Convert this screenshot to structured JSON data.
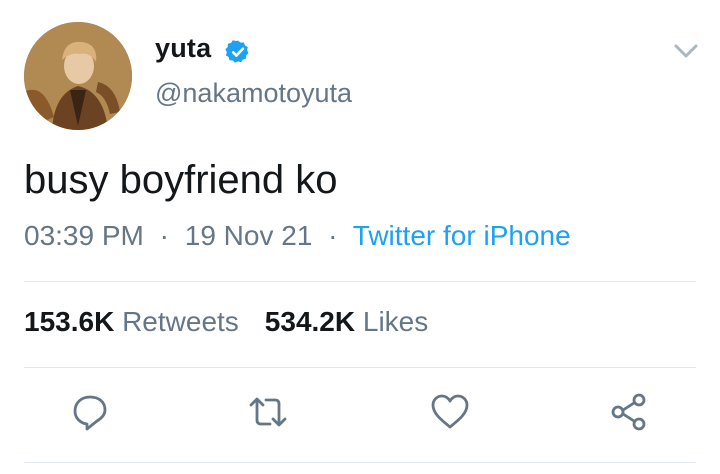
{
  "user": {
    "display_name": "yuta",
    "handle": "@nakamotoyuta",
    "verified": true
  },
  "tweet": {
    "text": "busy boyfriend ko",
    "time": "03:39 PM",
    "date": "19 Nov 21",
    "source": "Twitter for iPhone",
    "separator": "·"
  },
  "stats": {
    "retweets_count": "153.6K",
    "retweets_label": "Retweets",
    "likes_count": "534.2K",
    "likes_label": "Likes"
  },
  "icons": {
    "verified": "verified-badge-icon",
    "more": "chevron-down-icon",
    "reply": "reply-icon",
    "retweet": "retweet-icon",
    "like": "heart-icon",
    "share": "share-icon"
  },
  "colors": {
    "text": "#14171a",
    "secondary": "#657786",
    "accent": "#1da1f2",
    "divider": "#e1e8ed",
    "icon": "#657786"
  }
}
